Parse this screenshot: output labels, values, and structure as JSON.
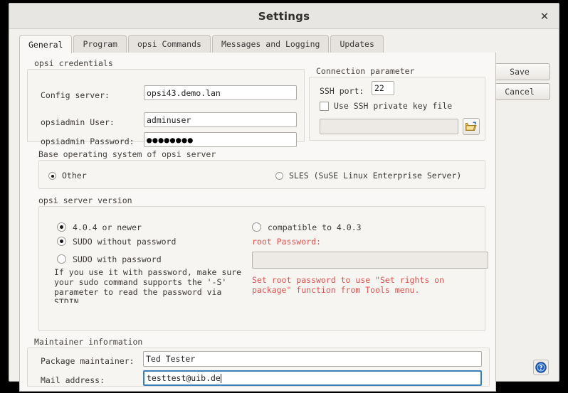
{
  "window": {
    "title": "Settings",
    "close_label": "✕"
  },
  "tabs": [
    {
      "label": "General",
      "active": true
    },
    {
      "label": "Program",
      "active": false
    },
    {
      "label": "opsi Commands",
      "active": false
    },
    {
      "label": "Messages and Logging",
      "active": false
    },
    {
      "label": "Updates",
      "active": false
    }
  ],
  "actions": {
    "save_label": "Save",
    "cancel_label": "Cancel",
    "help_icon": "help-icon"
  },
  "credentials": {
    "group_label": "opsi credentials",
    "config_server_label": "Config server:",
    "config_server_value": "opsi43.demo.lan",
    "user_label": "opsiadmin User:",
    "user_value": "adminuser",
    "password_label": "opsiadmin Password:",
    "password_value": "●●●●●●●●"
  },
  "connection": {
    "group_label": "Connection parameter",
    "ssh_port_label": "SSH port:",
    "ssh_port_value": "22",
    "use_key_label": "Use SSH private key file",
    "use_key_checked": false,
    "key_file_value": "",
    "browse_icon": "folder-open-icon"
  },
  "base_os": {
    "group_label": "Base operating system of opsi server",
    "options": [
      {
        "label": "Other",
        "checked": true
      },
      {
        "label": "SLES (SuSE Linux Enterprise Server)",
        "checked": false
      }
    ]
  },
  "server_version": {
    "group_label": "opsi server version",
    "option_404": "4.0.4 or newer",
    "option_404_checked": true,
    "option_403": "compatible to 4.0.3",
    "option_403_checked": false,
    "sudo_without": "SUDO without password",
    "sudo_without_checked": true,
    "sudo_with": "SUDO with password",
    "sudo_with_checked": false,
    "sudo_help": "If you use it with password, make sure\nyour sudo command supports the '-S'\nparameter to read the password via\nSTDIN",
    "root_password_label": "root Password:",
    "root_password_value": "",
    "root_password_hint": "Set root password to use \"Set rights on\npackage\" function from Tools menu."
  },
  "maintainer": {
    "group_label": "Maintainer information",
    "package_maintainer_label": "Package maintainer:",
    "package_maintainer_value": "Ted Tester",
    "mail_address_label": "Mail address:",
    "mail_address_value": "testtest@uib.de"
  },
  "colors": {
    "accent": "#3a7ebf",
    "warning": "#e0534f",
    "window_bg": "#f2f0ed",
    "panel_bg": "#faf8f6"
  }
}
